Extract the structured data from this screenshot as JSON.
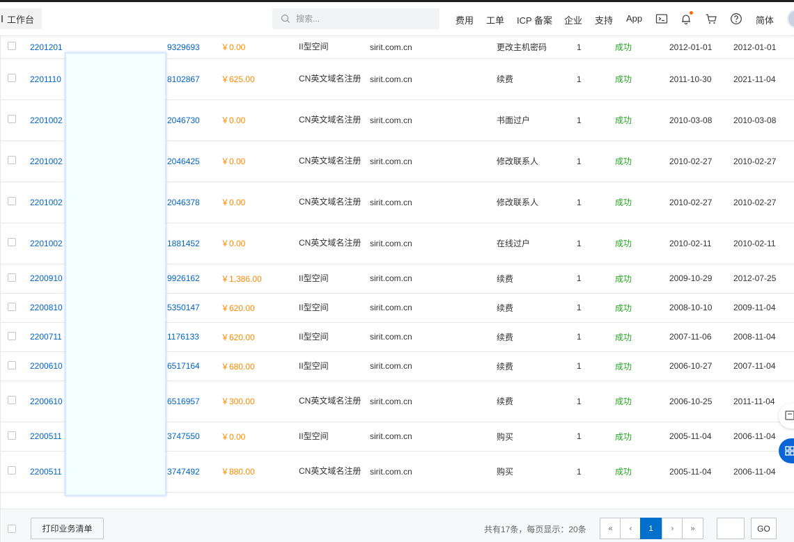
{
  "header": {
    "workbench_label": "工作台",
    "search_placeholder": "搜索...",
    "nav": [
      "费用",
      "工单",
      "ICP 备案",
      "企业",
      "支持",
      "App"
    ],
    "lang_label": "简体"
  },
  "colors": {
    "link": "#0064c8",
    "amount": "#ff8a00",
    "success": "#26a526",
    "primary": "#0070cc"
  },
  "rows": [
    {
      "id_prefix": "2201201",
      "id_suffix": "9329693",
      "amount": "￥0.00",
      "type": "II型空间",
      "domain": "sirit.com.cn",
      "op": "更改主机密码",
      "qty": "1",
      "status": "成功",
      "d1": "2012-01-01",
      "d2": "2012-01-01"
    },
    {
      "id_prefix": "2201110",
      "id_suffix": "8102867",
      "amount": "￥625.00",
      "type": "CN英文域名注册",
      "domain": "sirit.com.cn",
      "op": "续费",
      "qty": "1",
      "status": "成功",
      "d1": "2011-10-30",
      "d2": "2021-11-04"
    },
    {
      "id_prefix": "2201002",
      "id_suffix": "2046730",
      "amount": "￥0.00",
      "type": "CN英文域名注册",
      "domain": "sirit.com.cn",
      "op": "书面过户",
      "qty": "1",
      "status": "成功",
      "d1": "2010-03-08",
      "d2": "2010-03-08"
    },
    {
      "id_prefix": "2201002",
      "id_suffix": "2046425",
      "amount": "￥0.00",
      "type": "CN英文域名注册",
      "domain": "sirit.com.cn",
      "op": "修改联系人",
      "qty": "1",
      "status": "成功",
      "d1": "2010-02-27",
      "d2": "2010-02-27"
    },
    {
      "id_prefix": "2201002",
      "id_suffix": "2046378",
      "amount": "￥0.00",
      "type": "CN英文域名注册",
      "domain": "sirit.com.cn",
      "op": "修改联系人",
      "qty": "1",
      "status": "成功",
      "d1": "2010-02-27",
      "d2": "2010-02-27"
    },
    {
      "id_prefix": "2201002",
      "id_suffix": "1881452",
      "amount": "￥0.00",
      "type": "CN英文域名注册",
      "domain": "sirit.com.cn",
      "op": "在线过户",
      "qty": "1",
      "status": "成功",
      "d1": "2010-02-11",
      "d2": "2010-02-11"
    },
    {
      "id_prefix": "2200910",
      "id_suffix": "9926162",
      "amount": "￥1,386.00",
      "type": "II型空间",
      "domain": "sirit.com.cn",
      "op": "续费",
      "qty": "1",
      "status": "成功",
      "d1": "2009-10-29",
      "d2": "2012-07-25"
    },
    {
      "id_prefix": "2200810",
      "id_suffix": "5350147",
      "amount": "￥620.00",
      "type": "II型空间",
      "domain": "sirit.com.cn",
      "op": "续费",
      "qty": "1",
      "status": "成功",
      "d1": "2008-10-10",
      "d2": "2009-11-04"
    },
    {
      "id_prefix": "2200711",
      "id_suffix": "1176133",
      "amount": "￥620.00",
      "type": "II型空间",
      "domain": "sirit.com.cn",
      "op": "续费",
      "qty": "1",
      "status": "成功",
      "d1": "2007-11-06",
      "d2": "2008-11-04"
    },
    {
      "id_prefix": "2200610",
      "id_suffix": "6517164",
      "amount": "￥680.00",
      "type": "II型空间",
      "domain": "sirit.com.cn",
      "op": "续费",
      "qty": "1",
      "status": "成功",
      "d1": "2006-10-27",
      "d2": "2007-11-04"
    },
    {
      "id_prefix": "2200610",
      "id_suffix": "6516957",
      "amount": "￥300.00",
      "type": "CN英文域名注册",
      "domain": "sirit.com.cn",
      "op": "续费",
      "qty": "1",
      "status": "成功",
      "d1": "2006-10-25",
      "d2": "2011-11-04"
    },
    {
      "id_prefix": "2200511",
      "id_suffix": "3747550",
      "amount": "￥0.00",
      "type": "II型空间",
      "domain": "sirit.com.cn",
      "op": "购买",
      "qty": "1",
      "status": "成功",
      "d1": "2005-11-04",
      "d2": "2006-11-04"
    },
    {
      "id_prefix": "2200511",
      "id_suffix": "3747492",
      "amount": "￥880.00",
      "type": "CN英文域名注册",
      "domain": "sirit.com.cn",
      "op": "购买",
      "qty": "1",
      "status": "成功",
      "d1": "2005-11-04",
      "d2": "2006-11-04"
    }
  ],
  "footer": {
    "print_label": "打印业务清单",
    "summary": "共有17条，每页显示：20条",
    "pager": [
      "«",
      "‹",
      "1",
      "›",
      "»"
    ],
    "go_label": "GO"
  }
}
